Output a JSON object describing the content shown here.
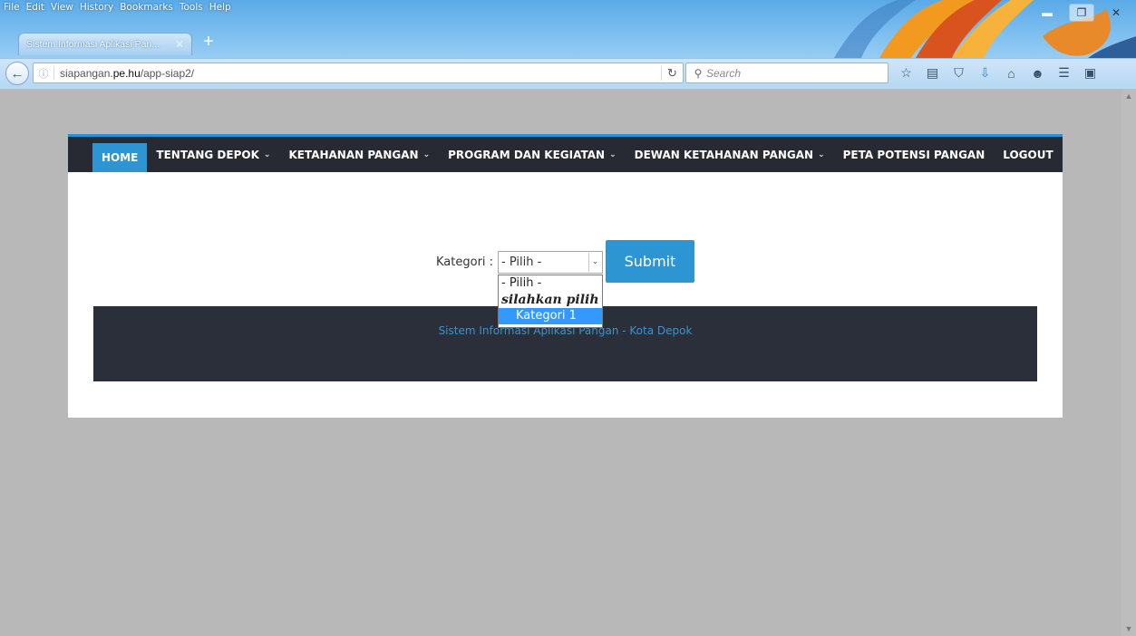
{
  "browser": {
    "menu": [
      "File",
      "Edit",
      "View",
      "History",
      "Bookmarks",
      "Tools",
      "Help"
    ],
    "tab_title": "Sistem Informasi Aplikasi Pan...",
    "new_tab": "+",
    "url_host": "siapangan.",
    "url_domain": "pe.hu",
    "url_path": "/app-siap2/",
    "search_placeholder": "Search"
  },
  "nav": {
    "items": [
      {
        "label": "HOME",
        "active": true
      },
      {
        "label": "TENTANG DEPOK",
        "chevron": "⌄"
      },
      {
        "label": "KETAHANAN PANGAN",
        "chevron": "⌄"
      },
      {
        "label": "PROGRAM DAN KEGIATAN",
        "chevron": "⌄"
      },
      {
        "label": "DEWAN KETAHANAN PANGAN",
        "chevron": "⌄"
      },
      {
        "label": "PETA POTENSI PANGAN"
      },
      {
        "label": "LOGOUT"
      }
    ]
  },
  "form": {
    "label": "Kategori :",
    "selected": "- Pilih -",
    "submit": "Submit",
    "options": [
      "- Pilih -",
      "silahkan pilih",
      "Kategori 1"
    ],
    "highlighted_option": "Kategori 1"
  },
  "footer": {
    "text": "Sistem Informasi Aplikasi Pangan - Kota Depok"
  },
  "colors": {
    "nav_bg": "#272a33",
    "accent": "#2e95d3",
    "footer_bg": "#2b2f39",
    "footer_text": "#3a93cf",
    "page_bg": "#b8b8b8"
  }
}
